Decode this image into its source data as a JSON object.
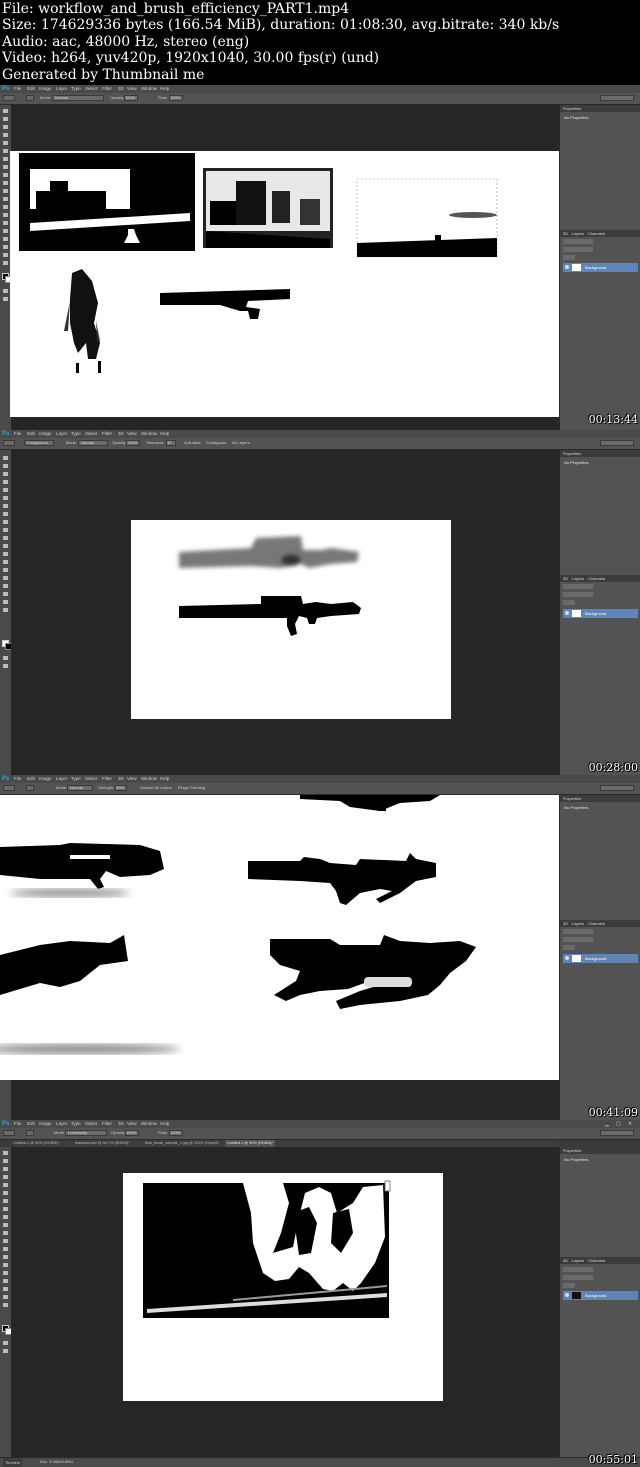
{
  "header": {
    "lines": [
      "File: workflow_and_brush_efficiency_PART1.mp4",
      "Size: 174629336 bytes (166.54 MiB), duration: 01:08:30, avg.bitrate: 340 kb/s",
      "Audio: aac, 48000 Hz, stereo (eng)",
      "Video: h264, yuv420p, 1920x1040, 30.00 fps(r) (und)",
      "Generated by Thumbnail me"
    ]
  },
  "app": {
    "logo": "Ps",
    "menu": [
      "File",
      "Edit",
      "Image",
      "Layer",
      "Type",
      "Select",
      "Filter",
      "3D",
      "View",
      "Window",
      "Help"
    ]
  },
  "panels": {
    "properties_tab": "Properties",
    "no_properties": "No Properties",
    "tab_3d": "3D",
    "tab_layers": "Layers",
    "tab_channels": "Channels",
    "layer_name": "Background",
    "kind": "P Kind",
    "blend": "Normal",
    "opacity": "Opacity:",
    "lock": "Lock:",
    "fill": "Fill:"
  },
  "frames": [
    {
      "timestamp": "00:13:44",
      "options": {
        "mode_label": "Mode:",
        "mode": "Normal",
        "opacity_label": "Opacity:",
        "opacity": "100%",
        "flow_label": "Flow:",
        "flow": "100%"
      }
    },
    {
      "timestamp": "00:28:00",
      "options": {
        "mode_label": "Mode:",
        "mode": "Normal",
        "opacity_label": "Opacity:",
        "opacity": "100%",
        "tolerance_label": "Tolerance:",
        "tolerance": "32",
        "antialias": "Anti-alias",
        "contiguous": "Contiguous",
        "all_layers": "All Layers",
        "fill_source": "Foreground"
      }
    },
    {
      "timestamp": "00:41:09",
      "options": {
        "mode_label": "Mode:",
        "mode": "Normal",
        "strength_label": "Strength:",
        "strength": "50%",
        "sample": "Sample All Layers",
        "finger": "Finger Painting"
      }
    },
    {
      "timestamp": "00:55:01",
      "options": {
        "mode_label": "Mode:",
        "mode": "Luminosity",
        "opacity_label": "Opacity:",
        "opacity": "100%",
        "flow_label": "Flow:",
        "flow": "100%"
      },
      "doc_tabs": [
        "Untitled-1 @ 50% (RGB/8)*",
        "blacklow.psd @ 66.7% (RGB/8)*",
        "Bad_brush_sample_1.jpg @ 100% (Gray/8)",
        "Untitled-1 @ 50% (RGB/8)*"
      ],
      "status_zoom": "50%",
      "status_doc": "Doc: 5.49M/3.65M",
      "timeline": "Timeline"
    }
  ]
}
